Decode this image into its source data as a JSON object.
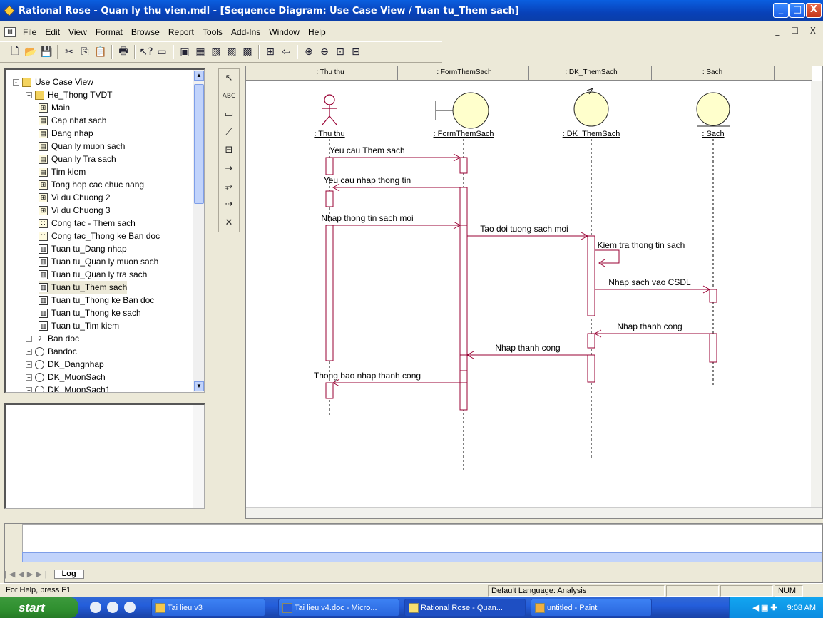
{
  "window": {
    "title": "Rational Rose - Quan ly thu vien.mdl - [Sequence Diagram: Use Case View / Tuan tu_Them sach]",
    "buttons": [
      "_",
      "□",
      "X"
    ]
  },
  "menubar": {
    "items": [
      "File",
      "Edit",
      "View",
      "Format",
      "Browse",
      "Report",
      "Tools",
      "Add-Ins",
      "Window",
      "Help"
    ],
    "mdi_buttons": "_ ☐ X"
  },
  "toolbar": {
    "icons": [
      "new-icon",
      "open-icon",
      "save-icon",
      "cut-icon",
      "copy-icon",
      "paste-icon",
      "print-icon",
      "context-help-icon",
      "view-doc-icon",
      "browse-class-icon",
      "browse-interaction-icon",
      "browse-component-icon",
      "browse-deployment-icon",
      "browse-parent-icon",
      "browse-previous-icon",
      "back-icon",
      "zoom-in-icon",
      "zoom-out-icon",
      "fit-window-icon",
      "undo-fit-icon"
    ]
  },
  "browser": {
    "items": [
      {
        "label": "Use Case View",
        "icon": "folder",
        "indent": 0,
        "expander": "-"
      },
      {
        "label": "He_Thong TVDT",
        "icon": "folder",
        "indent": 1,
        "expander": "+"
      },
      {
        "label": "Main",
        "icon": "usecase-diagram",
        "indent": 2
      },
      {
        "label": "Cap nhat sach",
        "icon": "usecase",
        "indent": 2
      },
      {
        "label": "Dang nhap",
        "icon": "usecase",
        "indent": 2
      },
      {
        "label": "Quan ly muon sach",
        "icon": "usecase",
        "indent": 2
      },
      {
        "label": "Quan ly Tra sach",
        "icon": "usecase",
        "indent": 2
      },
      {
        "label": "Tim kiem",
        "icon": "usecase",
        "indent": 2
      },
      {
        "label": "Tong hop cac chuc nang",
        "icon": "usecase-diagram",
        "indent": 2
      },
      {
        "label": "Vi du Chuong 2",
        "icon": "usecase-diagram",
        "indent": 2
      },
      {
        "label": "Vi du Chuong 3",
        "icon": "usecase-diagram",
        "indent": 2
      },
      {
        "label": "Cong tac - Them sach",
        "icon": "collab",
        "indent": 2
      },
      {
        "label": "Cong tac_Thong ke Ban doc",
        "icon": "collab",
        "indent": 2
      },
      {
        "label": "Tuan tu_Dang nhap",
        "icon": "sequence",
        "indent": 2
      },
      {
        "label": "Tuan tu_Quan ly muon sach",
        "icon": "sequence",
        "indent": 2
      },
      {
        "label": "Tuan tu_Quan ly tra sach",
        "icon": "sequence",
        "indent": 2
      },
      {
        "label": "Tuan tu_Them sach",
        "icon": "sequence",
        "indent": 2,
        "selected": true
      },
      {
        "label": "Tuan tu_Thong ke Ban doc",
        "icon": "sequence",
        "indent": 2
      },
      {
        "label": "Tuan tu_Thong ke sach",
        "icon": "sequence",
        "indent": 2
      },
      {
        "label": "Tuan tu_Tim kiem",
        "icon": "sequence",
        "indent": 2
      },
      {
        "label": "Ban doc",
        "icon": "actor",
        "indent": 1,
        "expander": "+"
      },
      {
        "label": "Bandoc",
        "icon": "class",
        "indent": 1,
        "expander": "+"
      },
      {
        "label": "DK_Dangnhap",
        "icon": "control",
        "indent": 1,
        "expander": "+"
      },
      {
        "label": "DK_MuonSach",
        "icon": "control",
        "indent": 1,
        "expander": "+"
      },
      {
        "label": "DK_MuonSach1",
        "icon": "control",
        "indent": 1,
        "expander": "+"
      }
    ]
  },
  "palette": {
    "tools": [
      {
        "name": "selection-tool-icon",
        "glyph": "↖"
      },
      {
        "name": "text-box-tool-icon",
        "glyph": "ABC"
      },
      {
        "name": "note-tool-icon",
        "glyph": "▭"
      },
      {
        "name": "anchor-note-tool-icon",
        "glyph": "⟋"
      },
      {
        "name": "object-tool-icon",
        "glyph": "⊟"
      },
      {
        "name": "object-message-tool-icon",
        "glyph": "→"
      },
      {
        "name": "message-to-self-tool-icon",
        "glyph": "⥅"
      },
      {
        "name": "return-message-tool-icon",
        "glyph": "⇢"
      },
      {
        "name": "destruction-marker-tool-icon",
        "glyph": "✕"
      }
    ]
  },
  "diagram": {
    "column_headers": [
      ": Thu thu",
      ": FormThemSach",
      ": DK_ThemSach",
      ": Sach"
    ],
    "objects": [
      {
        "label": ": Thu thu",
        "kind": "actor"
      },
      {
        "label": ": FormThemSach",
        "kind": "boundary"
      },
      {
        "label": ": DK_ThemSach",
        "kind": "control"
      },
      {
        "label": ": Sach",
        "kind": "entity"
      }
    ],
    "messages": [
      {
        "label": "Yeu cau Them sach",
        "from": 0,
        "to": 1
      },
      {
        "label": "Yeu cau nhap thong tin",
        "from": 1,
        "to": 0
      },
      {
        "label": "Nhap thong tin sach moi",
        "from": 0,
        "to": 1
      },
      {
        "label": "Tao doi tuong sach moi",
        "from": 1,
        "to": 2
      },
      {
        "label": "Kiem tra thong tin sach",
        "from": 2,
        "to": 2
      },
      {
        "label": "Nhap sach vao CSDL",
        "from": 2,
        "to": 3
      },
      {
        "label": "Nhap thanh cong",
        "from": 3,
        "to": 2
      },
      {
        "label": "Nhap thanh cong",
        "from": 2,
        "to": 1
      },
      {
        "label": "Thong bao nhap thanh cong",
        "from": 1,
        "to": 0
      }
    ],
    "line_color": "#990033"
  },
  "log": {
    "tab_label": "Log"
  },
  "status": {
    "help": "For Help, press F1",
    "language": "Default Language: Analysis",
    "num": "NUM"
  },
  "taskbar": {
    "start_label": "start",
    "tasks": [
      {
        "label": "Tai lieu v3",
        "active": false
      },
      {
        "label": "Tai lieu v4.doc - Micro...",
        "active": false
      },
      {
        "label": "Rational Rose - Quan...",
        "active": true
      },
      {
        "label": "untitled - Paint",
        "active": false
      }
    ],
    "clock": "9:08 AM"
  }
}
